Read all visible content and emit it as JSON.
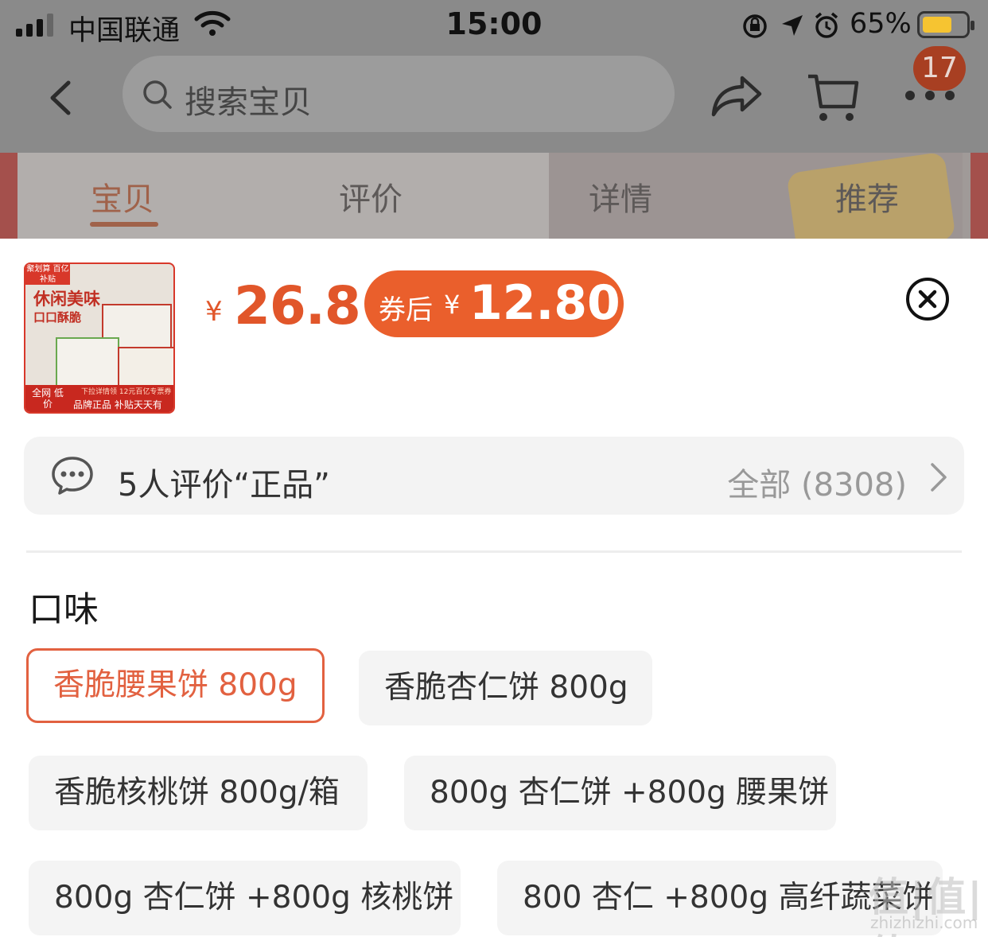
{
  "status_bar": {
    "carrier": "中国联通",
    "time": "15:00",
    "battery": "65%"
  },
  "nav": {
    "search_placeholder": "搜索宝贝",
    "cart_badge": "17"
  },
  "tabs": [
    {
      "label": "宝贝"
    },
    {
      "label": "评价"
    },
    {
      "label": "详情"
    },
    {
      "label": "推荐"
    }
  ],
  "product": {
    "thumb_tag": "聚划算 百亿补贴",
    "thumb_title": "休闲美味",
    "thumb_subtitle": "口口酥脆",
    "thumb_footer_left": "全网 低价",
    "thumb_footer_right": "品牌正品 补贴天天有",
    "thumb_footer_top": "下拉详情领 12元百亿专票券",
    "currency": "¥",
    "price": "26.8",
    "coupon_label": "券后",
    "coupon_currency": "¥",
    "coupon_price": "12.80"
  },
  "review": {
    "text": "5人评价“正品”",
    "all": "全部 (8308)"
  },
  "section_title": "口味",
  "options": [
    {
      "label": "香脆腰果饼 800g",
      "selected": true
    },
    {
      "label": "香脆杏仁饼 800g",
      "selected": false
    },
    {
      "label": "香脆核桃饼 800g/箱",
      "selected": false
    },
    {
      "label": "800g 杏仁饼 +800g 腰果饼",
      "selected": false
    },
    {
      "label": "800g 杏仁饼 +800g 核桃饼",
      "selected": false
    },
    {
      "label": "800 杏仁 +800g 高纤蔬菜饼",
      "selected": false
    }
  ],
  "watermark": "值|值|值",
  "watermark_url": "zhizhizhi.com",
  "colors": {
    "accent": "#E1562A",
    "coupon_bg": "#EA5F2C",
    "selected_border": "#E26140",
    "overlay": "#8A8A8A"
  }
}
